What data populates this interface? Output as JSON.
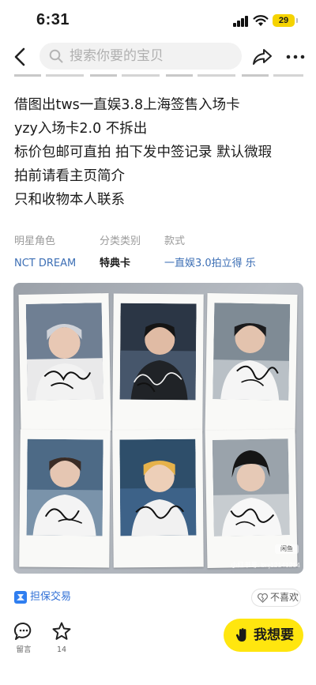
{
  "status_bar": {
    "time": "6:31",
    "battery_level": "29"
  },
  "search": {
    "placeholder": "搜索你要的宝贝"
  },
  "description": {
    "lines": [
      "借图出tws一直娱3.8上海签售入场卡",
      "yzy入场卡2.0 不拆出",
      "标价包邮可直拍 拍下发中签记录 默认微瑕",
      "拍前请看主页简介",
      "只和收物本人联系"
    ]
  },
  "attributes": [
    {
      "label": "明星角色",
      "value": "NCT DREAM"
    },
    {
      "label": "分类类别",
      "value": "特典卡"
    },
    {
      "label": "款式",
      "value": "一直娱3.0拍立得 乐"
    }
  ],
  "photo": {
    "watermark_logo": "闲鱼",
    "watermark_id": "小红书号: bnj12141214"
  },
  "guarantee": {
    "label": "担保交易"
  },
  "dislike": {
    "label": "不喜欢"
  },
  "bottom_bar": {
    "comment_label": "留言",
    "favorite_count": "14",
    "want_label": "我想要"
  },
  "colors": {
    "accent_yellow": "#ffe60f",
    "link_blue": "#3d6fb5",
    "guarantee_blue": "#2f7ef0"
  },
  "icons": [
    "back-icon",
    "search-icon",
    "share-icon",
    "more-icon",
    "shield-icon",
    "heart-broken-icon",
    "comment-icon",
    "star-icon",
    "hand-icon"
  ]
}
